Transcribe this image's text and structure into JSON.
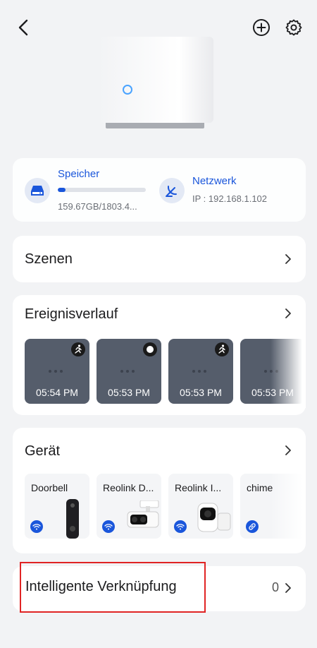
{
  "header": {
    "back_icon": "chevron-left-icon",
    "add_icon": "plus-circle-icon",
    "settings_icon": "gear-icon"
  },
  "status": {
    "storage": {
      "title": "Speicher",
      "value": "159.67GB/1803.4...",
      "progress": 0.09,
      "icon": "hard-drive-icon"
    },
    "network": {
      "title": "Netzwerk",
      "value": "IP : 192.168.1.102",
      "icon": "satellite-icon"
    }
  },
  "scenes": {
    "title": "Szenen"
  },
  "events": {
    "title": "Ereignisverlauf",
    "items": [
      {
        "time": "05:54 PM",
        "badge": "person-running-icon"
      },
      {
        "time": "05:53 PM",
        "badge": "ring-icon"
      },
      {
        "time": "05:53 PM",
        "badge": "person-running-icon"
      },
      {
        "time": "05:53 PM",
        "badge": ""
      }
    ]
  },
  "devices": {
    "title": "Gerät",
    "items": [
      {
        "name": "Doorbell",
        "conn": "wifi-icon"
      },
      {
        "name": "Reolink D...",
        "conn": "wifi-icon"
      },
      {
        "name": "Reolink I...",
        "conn": "wifi-icon"
      },
      {
        "name": "chime",
        "conn": "link-icon"
      }
    ]
  },
  "linkage": {
    "title": "Intelligente Verknüpfung",
    "count": "0"
  },
  "colors": {
    "accent": "#1a56db",
    "highlight": "#e02424"
  }
}
